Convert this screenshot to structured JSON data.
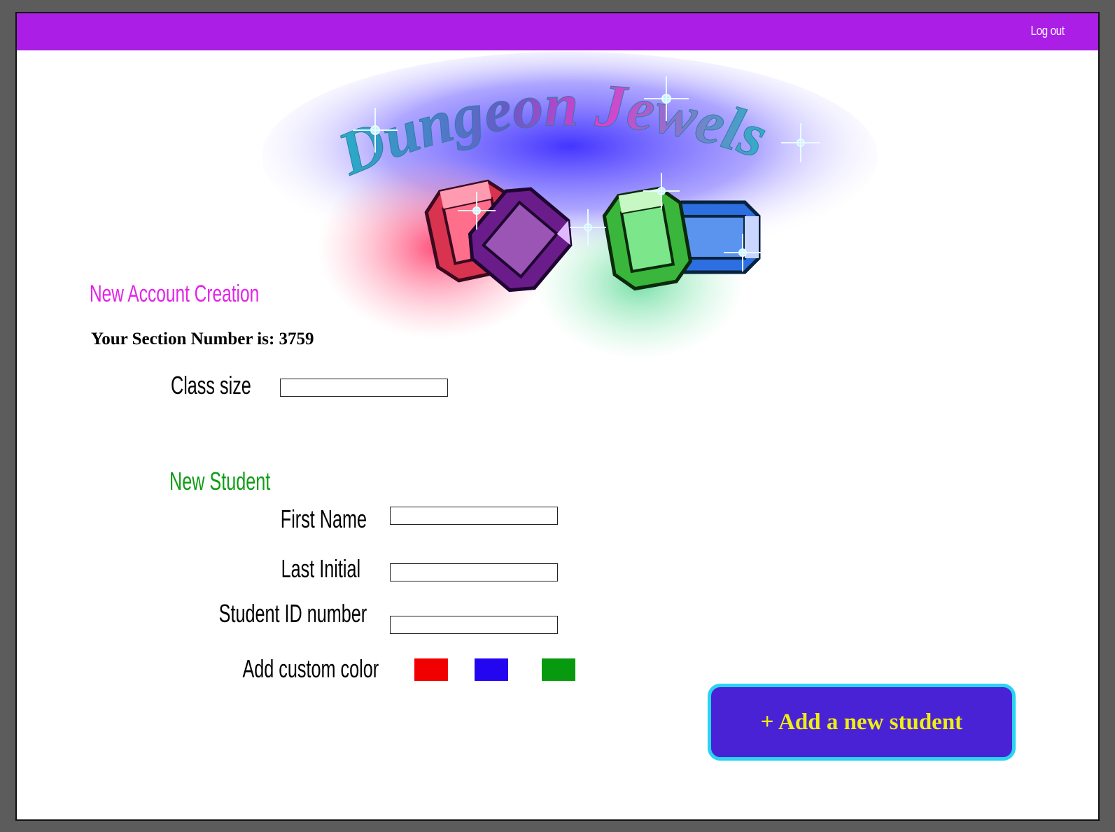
{
  "header": {
    "logout_label": "Log out"
  },
  "logo": {
    "title": "Dungeon Jewels"
  },
  "page": {
    "heading": "New Account Creation",
    "section_label": "Your Section Number is: 3759"
  },
  "class_size": {
    "label": "Class size",
    "value": ""
  },
  "new_student": {
    "heading": "New Student",
    "first_name_label": "First Name",
    "first_name_value": "",
    "last_initial_label": "Last Initial",
    "last_initial_value": "",
    "student_id_label": "Student ID number",
    "student_id_value": "",
    "custom_color_label": "Add custom color",
    "colors": [
      "#f10000",
      "#2305f0",
      "#07990e"
    ]
  },
  "add_button": {
    "label": "+ Add a new student"
  },
  "theme": {
    "topbar": "#aa1ee6",
    "heading_color": "#e323e8",
    "student_heading_color": "#0f9d16",
    "button_bg": "#4a22d6",
    "button_border": "#28d4f2",
    "button_text": "#eef00e"
  }
}
